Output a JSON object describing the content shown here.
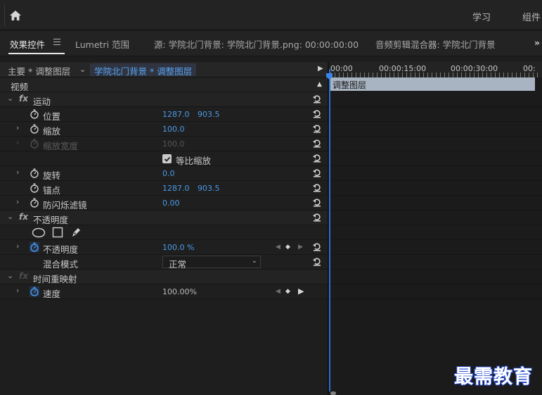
{
  "topbar": {
    "workspaces": [
      "学习",
      "组件"
    ]
  },
  "panel_tabs": {
    "effect_controls": "效果控件",
    "lumetri": "Lumetri 范围",
    "source": "源: 学院北门背景: 学院北门背景.png: 00:00:00:00",
    "audio_mixer": "音频剪辑混合器: 学院北门背景",
    "more": "»"
  },
  "header": {
    "master": "主要 * 调整图层",
    "clip": "学院北门背景 * 调整图层"
  },
  "section_video": "视频",
  "motion": {
    "title": "运动",
    "position": {
      "label": "位置",
      "x": "1287.0",
      "y": "903.5"
    },
    "scale": {
      "label": "缩放",
      "value": "100.0"
    },
    "scale_width": {
      "label": "缩放宽度",
      "value": "100.0"
    },
    "uniform_scale": {
      "label": "等比缩放",
      "checked": true
    },
    "rotation": {
      "label": "旋转",
      "value": "0.0"
    },
    "anchor": {
      "label": "锚点",
      "x": "1287.0",
      "y": "903.5"
    },
    "anti_flicker": {
      "label": "防闪烁滤镜",
      "value": "0.00"
    }
  },
  "opacity": {
    "title": "不透明度",
    "opacity": {
      "label": "不透明度",
      "value": "100.0 %"
    },
    "blend": {
      "label": "混合模式",
      "value": "正常"
    }
  },
  "time_remap": {
    "title": "时间重映射",
    "speed": {
      "label": "速度",
      "value": "100.00%"
    }
  },
  "timeline": {
    "timecodes": [
      "00:00",
      "00:00:15:00",
      "00:00:30:00",
      "00:"
    ],
    "clip_label": "调整图层"
  },
  "watermark": "最需教育",
  "colors": {
    "accent": "#4b9ae6",
    "clip_bar": "#a8b4c2",
    "playhead": "#2e6fd1"
  }
}
